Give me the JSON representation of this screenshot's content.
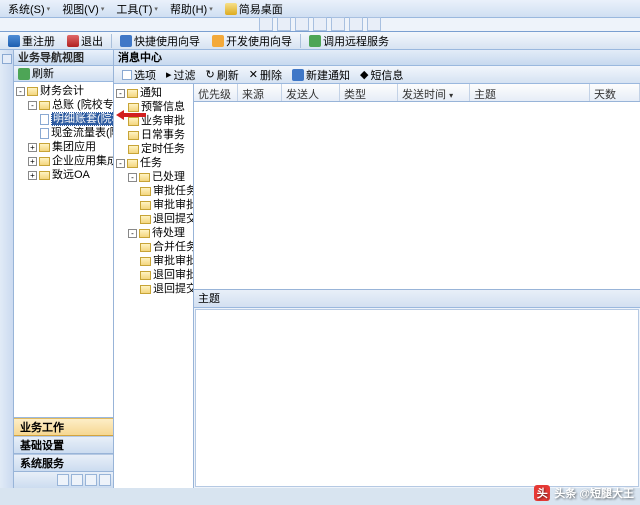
{
  "menubar": {
    "items": [
      "系统(S)",
      "视图(V)",
      "工具(T)",
      "帮助(H)"
    ],
    "desktop": "简易桌面"
  },
  "toolbar": {
    "register": "重注册",
    "exit": "退出",
    "quick_guide": "快捷使用向导",
    "dev_guide": "开发使用向导",
    "remote_service": "调用远程服务"
  },
  "left": {
    "title": "业务导航视图",
    "refresh": "刷新",
    "tree": {
      "root": "财务会计",
      "ledger": "总账 (院校专版)",
      "gl_selected": "明细账套(院校专版)",
      "cashflow": "现金流量表(院校专版)",
      "group": "集团应用",
      "enterprise": "企业应用集成",
      "zhijiang": "致远OA"
    },
    "stack": {
      "biz": "业务工作",
      "basic": "基础设置",
      "sys": "系统服务"
    }
  },
  "center_tree": {
    "notice": "通知",
    "alert": "预警信息",
    "biz_approve": "业务审批",
    "daily": "日常事务",
    "timed": "定时任务",
    "tasks": "任务",
    "done": "已处理",
    "approved": "审批任务",
    "audited": "审批审批",
    "back1": "退回提交",
    "pending": "待处理",
    "merge": "合并任务",
    "audit2": "审批审批",
    "return_audit": "退回审批",
    "return_submit": "退回提交"
  },
  "right": {
    "title": "消息中心",
    "tools": {
      "option": "选项",
      "filter": "过滤",
      "refresh": "刷新",
      "delete": "删除",
      "new": "新建通知",
      "sms": "短信息"
    },
    "columns": {
      "priority": "优先级",
      "source": "来源",
      "sender": "发送人",
      "type": "类型",
      "sendtime": "发送时间",
      "subject": "主题",
      "days": "天数"
    },
    "subject_label": "主题"
  },
  "watermark": "头条 @短腿大王"
}
